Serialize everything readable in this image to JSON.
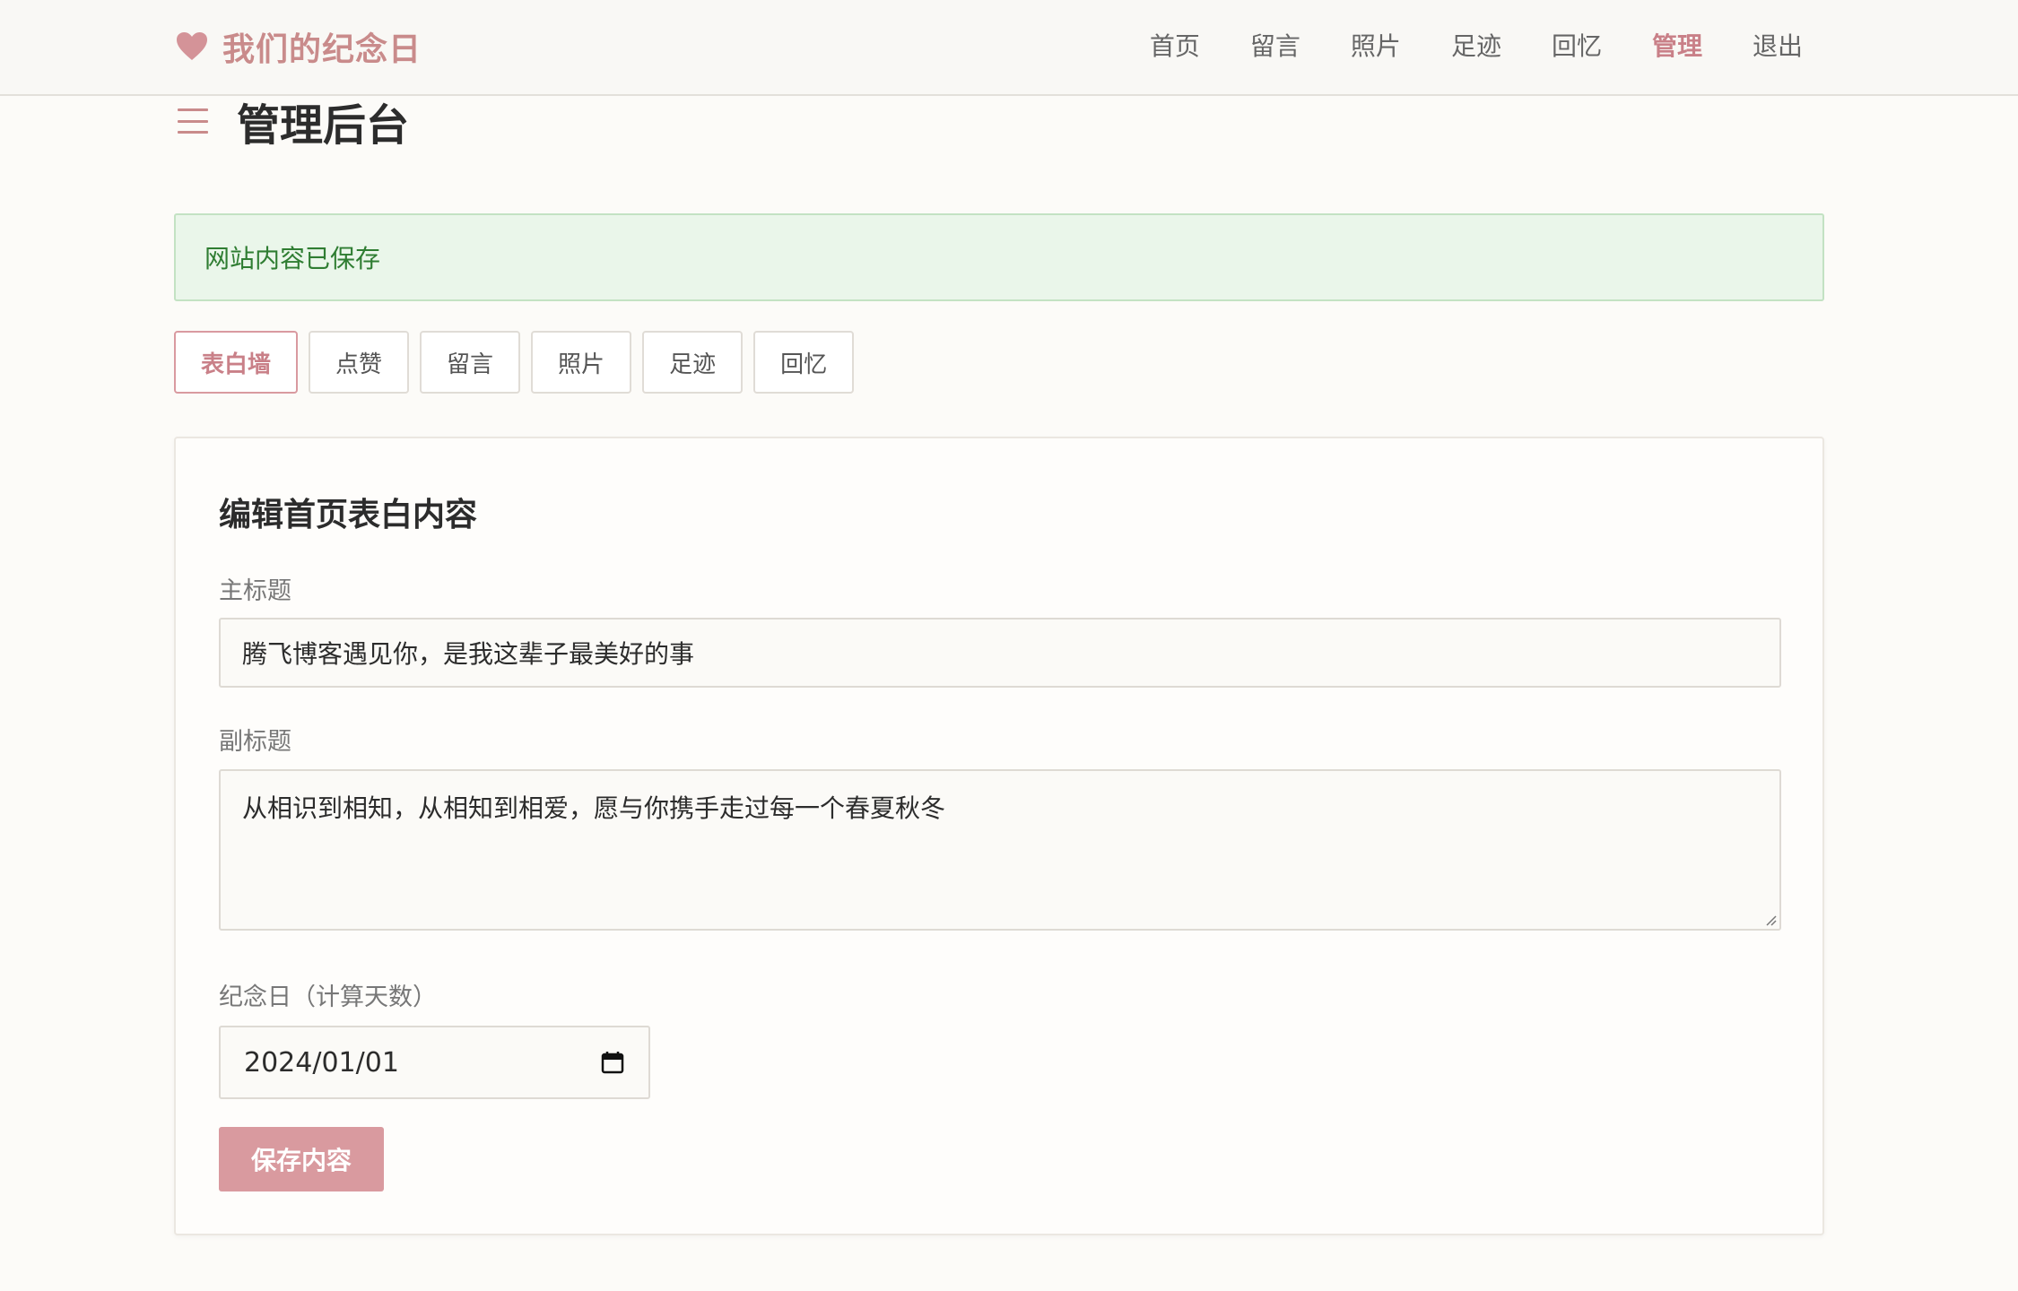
{
  "header": {
    "brand_icon": "heart-icon",
    "brand_title": "我们的纪念日",
    "nav": [
      {
        "label": "首页"
      },
      {
        "label": "留言"
      },
      {
        "label": "照片"
      },
      {
        "label": "足迹"
      },
      {
        "label": "回忆"
      },
      {
        "label": "管理",
        "active": true
      },
      {
        "label": "退出"
      }
    ]
  },
  "page": {
    "menu_icon": "hamburger-icon",
    "title": "管理后台"
  },
  "alert": {
    "text": "网站内容已保存",
    "type": "success"
  },
  "tabs": [
    {
      "label": "表白墙",
      "active": true
    },
    {
      "label": "点赞"
    },
    {
      "label": "留言"
    },
    {
      "label": "照片"
    },
    {
      "label": "足迹"
    },
    {
      "label": "回忆"
    }
  ],
  "form": {
    "title": "编辑首页表白内容",
    "main_title_label": "主标题",
    "main_title_value": "腾飞博客遇见你，是我这辈子最美好的事",
    "subtitle_label": "副标题",
    "subtitle_value": "从相识到相知，从相知到相爱，愿与你携手走过每一个春夏秋冬",
    "date_label": "纪念日（计算天数）",
    "date_value": "2024/01/01",
    "date_icon": "calendar-icon",
    "save_label": "保存内容"
  },
  "colors": {
    "accent": "#c98b8b",
    "button": "#d99a9f",
    "success_bg": "#eaf6ea",
    "success_text": "#2f7d32",
    "page_bg": "#fcfbf8"
  }
}
